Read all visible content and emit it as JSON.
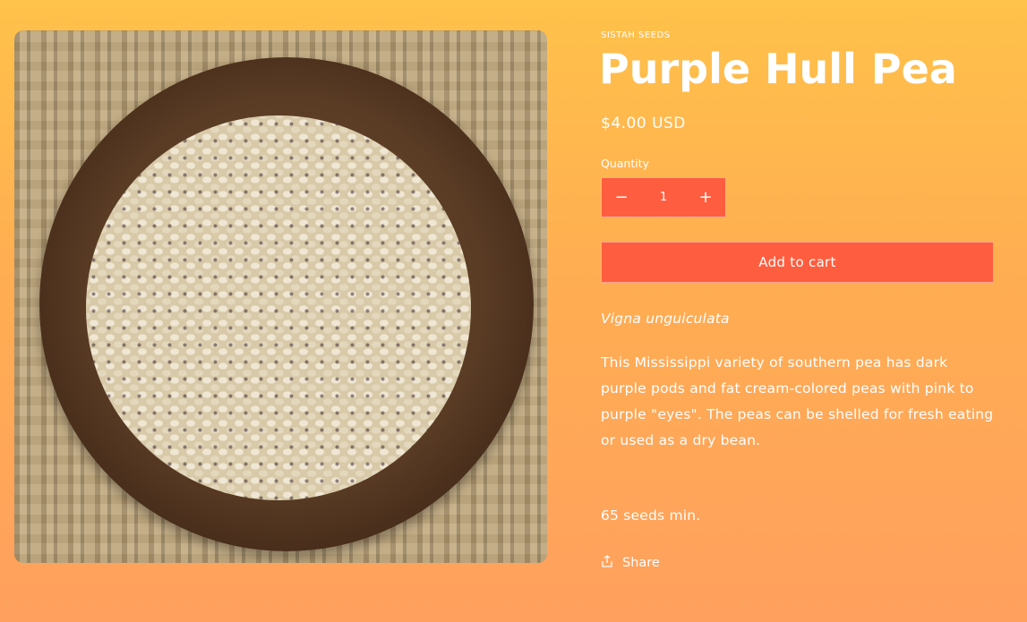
{
  "product": {
    "vendor": "SISTAH SEEDS",
    "title": "Purple Hull Pea",
    "price": "$4.00 USD",
    "image_alt": "Bowl of purple hull peas on woven mat"
  },
  "quantity": {
    "label": "Quantity",
    "value": "1",
    "decrease_symbol": "−",
    "increase_symbol": "+"
  },
  "actions": {
    "add_to_cart": "Add to cart",
    "share": "Share"
  },
  "description": {
    "latin_name": "Vigna unguiculata",
    "body": "This Mississippi variety of southern pea has dark purple pods and fat cream-colored peas with pink to purple \"eyes\". The peas can be shelled for fresh eating or used as a dry bean.",
    "seed_count": "65 seeds min."
  },
  "colors": {
    "accent": "#ff5d3f",
    "background_top": "#ffc24a",
    "background_bottom": "#ffa05e"
  }
}
